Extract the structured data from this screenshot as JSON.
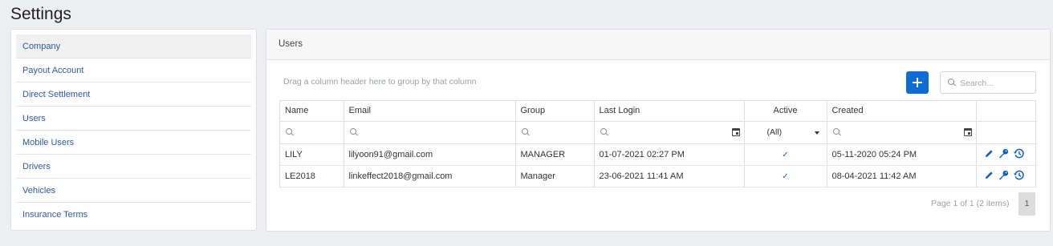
{
  "page_title": "Settings",
  "sidebar": {
    "items": [
      {
        "label": "Company",
        "active": true
      },
      {
        "label": "Payout Account"
      },
      {
        "label": "Direct Settlement"
      },
      {
        "label": "Users"
      },
      {
        "label": "Mobile Users"
      },
      {
        "label": "Drivers"
      },
      {
        "label": "Vehicles"
      },
      {
        "label": "Insurance Terms"
      }
    ]
  },
  "panel": {
    "title": "Users",
    "group_hint": "Drag a column header here to group by that column",
    "search_placeholder": "Search...",
    "add_icon": "plus-icon",
    "accent_color": "#0f6bd6"
  },
  "grid": {
    "columns": [
      "Name",
      "Email",
      "Group",
      "Last Login",
      "Active",
      "Created",
      ""
    ],
    "active_filter": "(All)",
    "rows": [
      {
        "name": "LILY",
        "email": "lilyoon91@gmail.com",
        "group": "MANAGER",
        "last_login": "01-07-2021 02:27 PM",
        "active": true,
        "created": "05-11-2020 05:24 PM"
      },
      {
        "name": "LE2018",
        "email": "linkeffect2018@gmail.com",
        "group": "Manager",
        "last_login": "23-06-2021 11:41 AM",
        "active": true,
        "created": "08-04-2021 11:42 AM"
      }
    ],
    "row_action_icons": [
      "pencil-icon",
      "key-icon",
      "history-icon"
    ]
  },
  "pager": {
    "info": "Page 1 of 1 (2 items)",
    "current_page": "1"
  }
}
